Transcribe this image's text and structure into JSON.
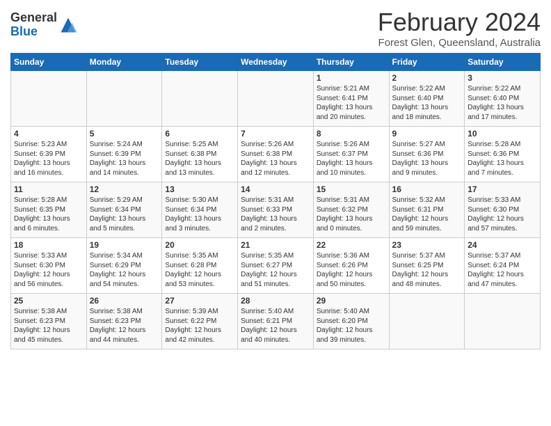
{
  "header": {
    "logo_general": "General",
    "logo_blue": "Blue",
    "title": "February 2024",
    "subtitle": "Forest Glen, Queensland, Australia"
  },
  "weekdays": [
    "Sunday",
    "Monday",
    "Tuesday",
    "Wednesday",
    "Thursday",
    "Friday",
    "Saturday"
  ],
  "weeks": [
    [
      {
        "day": "",
        "info": ""
      },
      {
        "day": "",
        "info": ""
      },
      {
        "day": "",
        "info": ""
      },
      {
        "day": "",
        "info": ""
      },
      {
        "day": "1",
        "info": "Sunrise: 5:21 AM\nSunset: 6:41 PM\nDaylight: 13 hours\nand 20 minutes."
      },
      {
        "day": "2",
        "info": "Sunrise: 5:22 AM\nSunset: 6:40 PM\nDaylight: 13 hours\nand 18 minutes."
      },
      {
        "day": "3",
        "info": "Sunrise: 5:22 AM\nSunset: 6:40 PM\nDaylight: 13 hours\nand 17 minutes."
      }
    ],
    [
      {
        "day": "4",
        "info": "Sunrise: 5:23 AM\nSunset: 6:39 PM\nDaylight: 13 hours\nand 16 minutes."
      },
      {
        "day": "5",
        "info": "Sunrise: 5:24 AM\nSunset: 6:39 PM\nDaylight: 13 hours\nand 14 minutes."
      },
      {
        "day": "6",
        "info": "Sunrise: 5:25 AM\nSunset: 6:38 PM\nDaylight: 13 hours\nand 13 minutes."
      },
      {
        "day": "7",
        "info": "Sunrise: 5:26 AM\nSunset: 6:38 PM\nDaylight: 13 hours\nand 12 minutes."
      },
      {
        "day": "8",
        "info": "Sunrise: 5:26 AM\nSunset: 6:37 PM\nDaylight: 13 hours\nand 10 minutes."
      },
      {
        "day": "9",
        "info": "Sunrise: 5:27 AM\nSunset: 6:36 PM\nDaylight: 13 hours\nand 9 minutes."
      },
      {
        "day": "10",
        "info": "Sunrise: 5:28 AM\nSunset: 6:36 PM\nDaylight: 13 hours\nand 7 minutes."
      }
    ],
    [
      {
        "day": "11",
        "info": "Sunrise: 5:28 AM\nSunset: 6:35 PM\nDaylight: 13 hours\nand 6 minutes."
      },
      {
        "day": "12",
        "info": "Sunrise: 5:29 AM\nSunset: 6:34 PM\nDaylight: 13 hours\nand 5 minutes."
      },
      {
        "day": "13",
        "info": "Sunrise: 5:30 AM\nSunset: 6:34 PM\nDaylight: 13 hours\nand 3 minutes."
      },
      {
        "day": "14",
        "info": "Sunrise: 5:31 AM\nSunset: 6:33 PM\nDaylight: 13 hours\nand 2 minutes."
      },
      {
        "day": "15",
        "info": "Sunrise: 5:31 AM\nSunset: 6:32 PM\nDaylight: 13 hours\nand 0 minutes."
      },
      {
        "day": "16",
        "info": "Sunrise: 5:32 AM\nSunset: 6:31 PM\nDaylight: 12 hours\nand 59 minutes."
      },
      {
        "day": "17",
        "info": "Sunrise: 5:33 AM\nSunset: 6:30 PM\nDaylight: 12 hours\nand 57 minutes."
      }
    ],
    [
      {
        "day": "18",
        "info": "Sunrise: 5:33 AM\nSunset: 6:30 PM\nDaylight: 12 hours\nand 56 minutes."
      },
      {
        "day": "19",
        "info": "Sunrise: 5:34 AM\nSunset: 6:29 PM\nDaylight: 12 hours\nand 54 minutes."
      },
      {
        "day": "20",
        "info": "Sunrise: 5:35 AM\nSunset: 6:28 PM\nDaylight: 12 hours\nand 53 minutes."
      },
      {
        "day": "21",
        "info": "Sunrise: 5:35 AM\nSunset: 6:27 PM\nDaylight: 12 hours\nand 51 minutes."
      },
      {
        "day": "22",
        "info": "Sunrise: 5:36 AM\nSunset: 6:26 PM\nDaylight: 12 hours\nand 50 minutes."
      },
      {
        "day": "23",
        "info": "Sunrise: 5:37 AM\nSunset: 6:25 PM\nDaylight: 12 hours\nand 48 minutes."
      },
      {
        "day": "24",
        "info": "Sunrise: 5:37 AM\nSunset: 6:24 PM\nDaylight: 12 hours\nand 47 minutes."
      }
    ],
    [
      {
        "day": "25",
        "info": "Sunrise: 5:38 AM\nSunset: 6:23 PM\nDaylight: 12 hours\nand 45 minutes."
      },
      {
        "day": "26",
        "info": "Sunrise: 5:38 AM\nSunset: 6:23 PM\nDaylight: 12 hours\nand 44 minutes."
      },
      {
        "day": "27",
        "info": "Sunrise: 5:39 AM\nSunset: 6:22 PM\nDaylight: 12 hours\nand 42 minutes."
      },
      {
        "day": "28",
        "info": "Sunrise: 5:40 AM\nSunset: 6:21 PM\nDaylight: 12 hours\nand 40 minutes."
      },
      {
        "day": "29",
        "info": "Sunrise: 5:40 AM\nSunset: 6:20 PM\nDaylight: 12 hours\nand 39 minutes."
      },
      {
        "day": "",
        "info": ""
      },
      {
        "day": "",
        "info": ""
      }
    ]
  ]
}
